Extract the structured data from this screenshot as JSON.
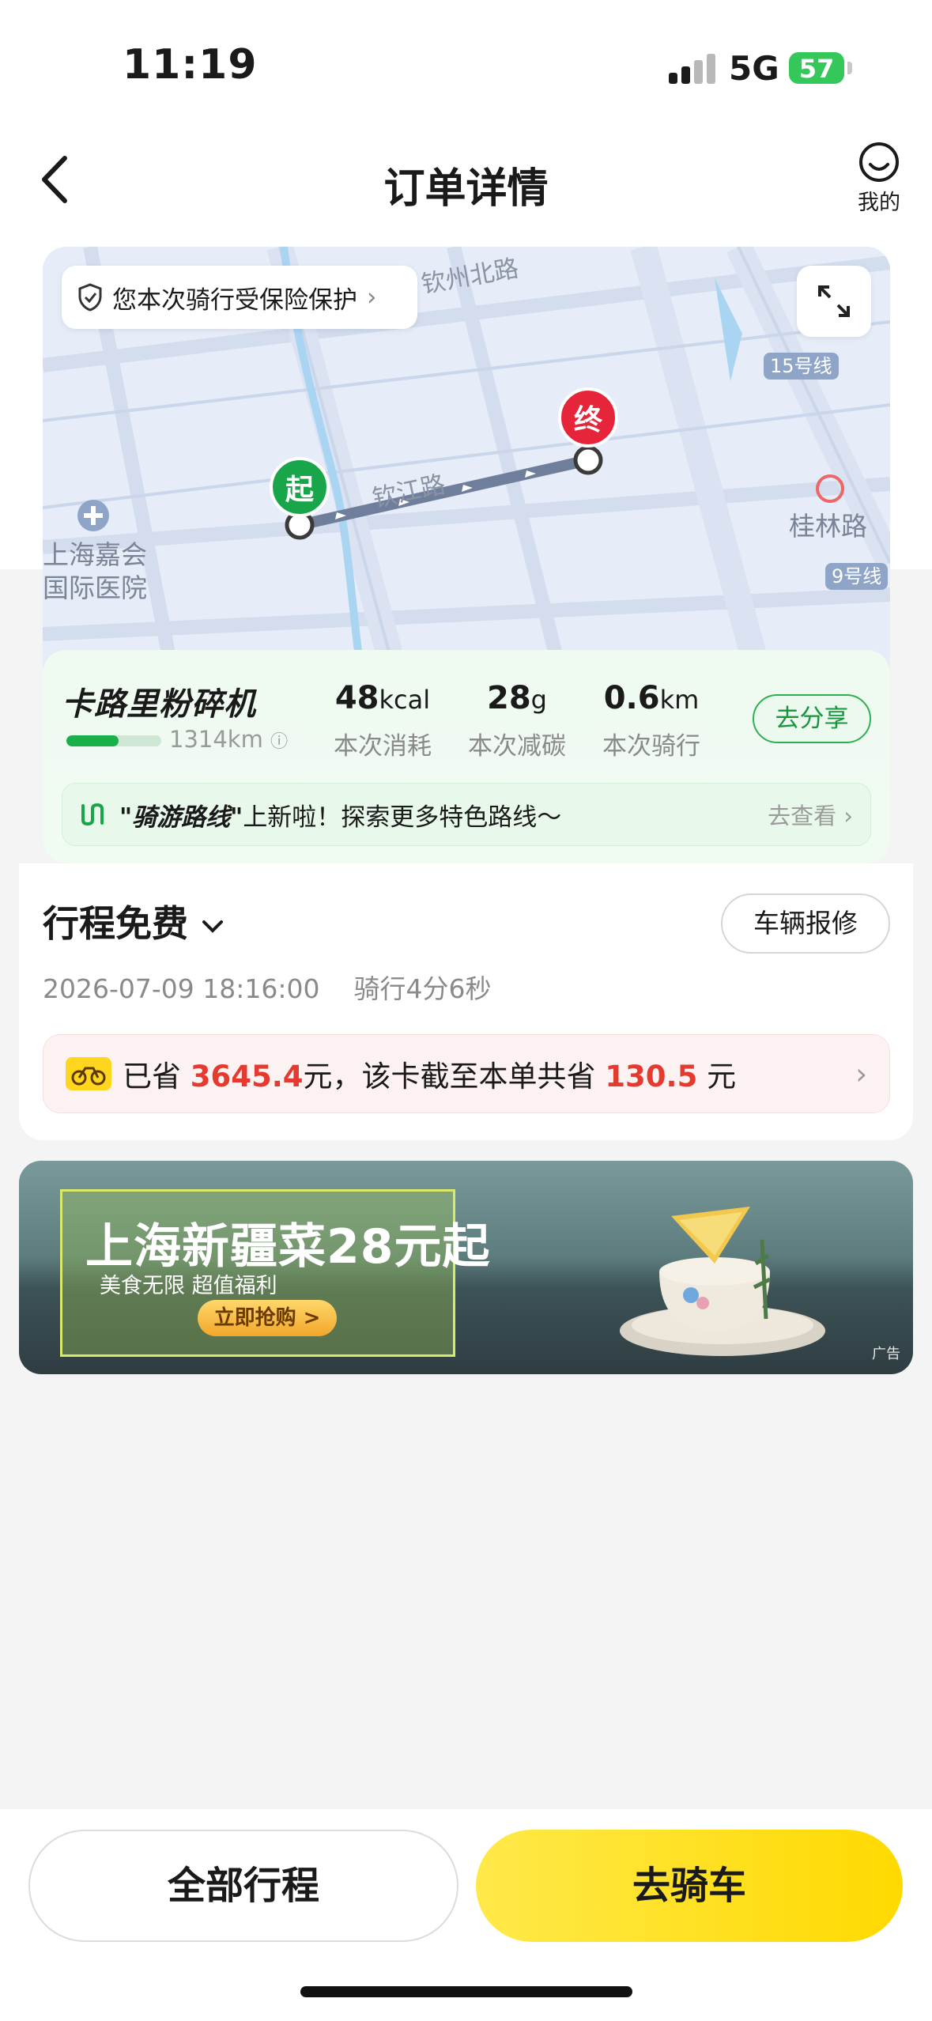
{
  "status_bar": {
    "time": "11:19",
    "network": "5G",
    "battery": "57"
  },
  "nav": {
    "title": "订单详情",
    "mine_label": "我的"
  },
  "map": {
    "insurance_text": "您本次骑行受保险保护",
    "labels": {
      "road_qinzhou": "钦州北路",
      "road_qinjiang": "钦江路",
      "poi_hospital_1": "上海嘉会",
      "poi_hospital_2": "国际医院",
      "station_guilin": "桂林路",
      "line_15": "15号线",
      "line_9": "9号线"
    },
    "start_pin": "起",
    "end_pin": "终"
  },
  "stats": {
    "brand": "卡路里粉碎机",
    "total_distance": "1314km",
    "progress_fraction": 0.55,
    "items": [
      {
        "value": "48",
        "unit": "kcal",
        "label": "本次消耗"
      },
      {
        "value": "28",
        "unit": "g",
        "label": "本次减碳"
      },
      {
        "value": "0.6",
        "unit": "km",
        "label": "本次骑行"
      }
    ],
    "share_label": "去分享"
  },
  "route_banner": {
    "highlight": "\"骑游路线\"",
    "text": "上新啦！探索更多特色路线～",
    "more": "去查看"
  },
  "trip": {
    "title": "行程免费",
    "repair_label": "车辆报修",
    "datetime": "2026-07-09 18:16:00",
    "duration": "骑行4分6秒",
    "savings_prefix": "已省",
    "savings_amount": "3645.4",
    "savings_mid": "元，该卡截至本单共省",
    "savings_total": "130.5",
    "savings_suffix": "元"
  },
  "ad": {
    "title": "上海新疆菜28元起",
    "subtitle": "美食无限 超值福利",
    "cta": "立即抢购 >",
    "tag": "广告"
  },
  "bottom": {
    "all_trips": "全部行程",
    "go_ride": "去骑车"
  },
  "colors": {
    "brand_yellow": "#ffd900",
    "green": "#19a64a",
    "red": "#e6243a",
    "savings_red": "#e43a2f"
  }
}
